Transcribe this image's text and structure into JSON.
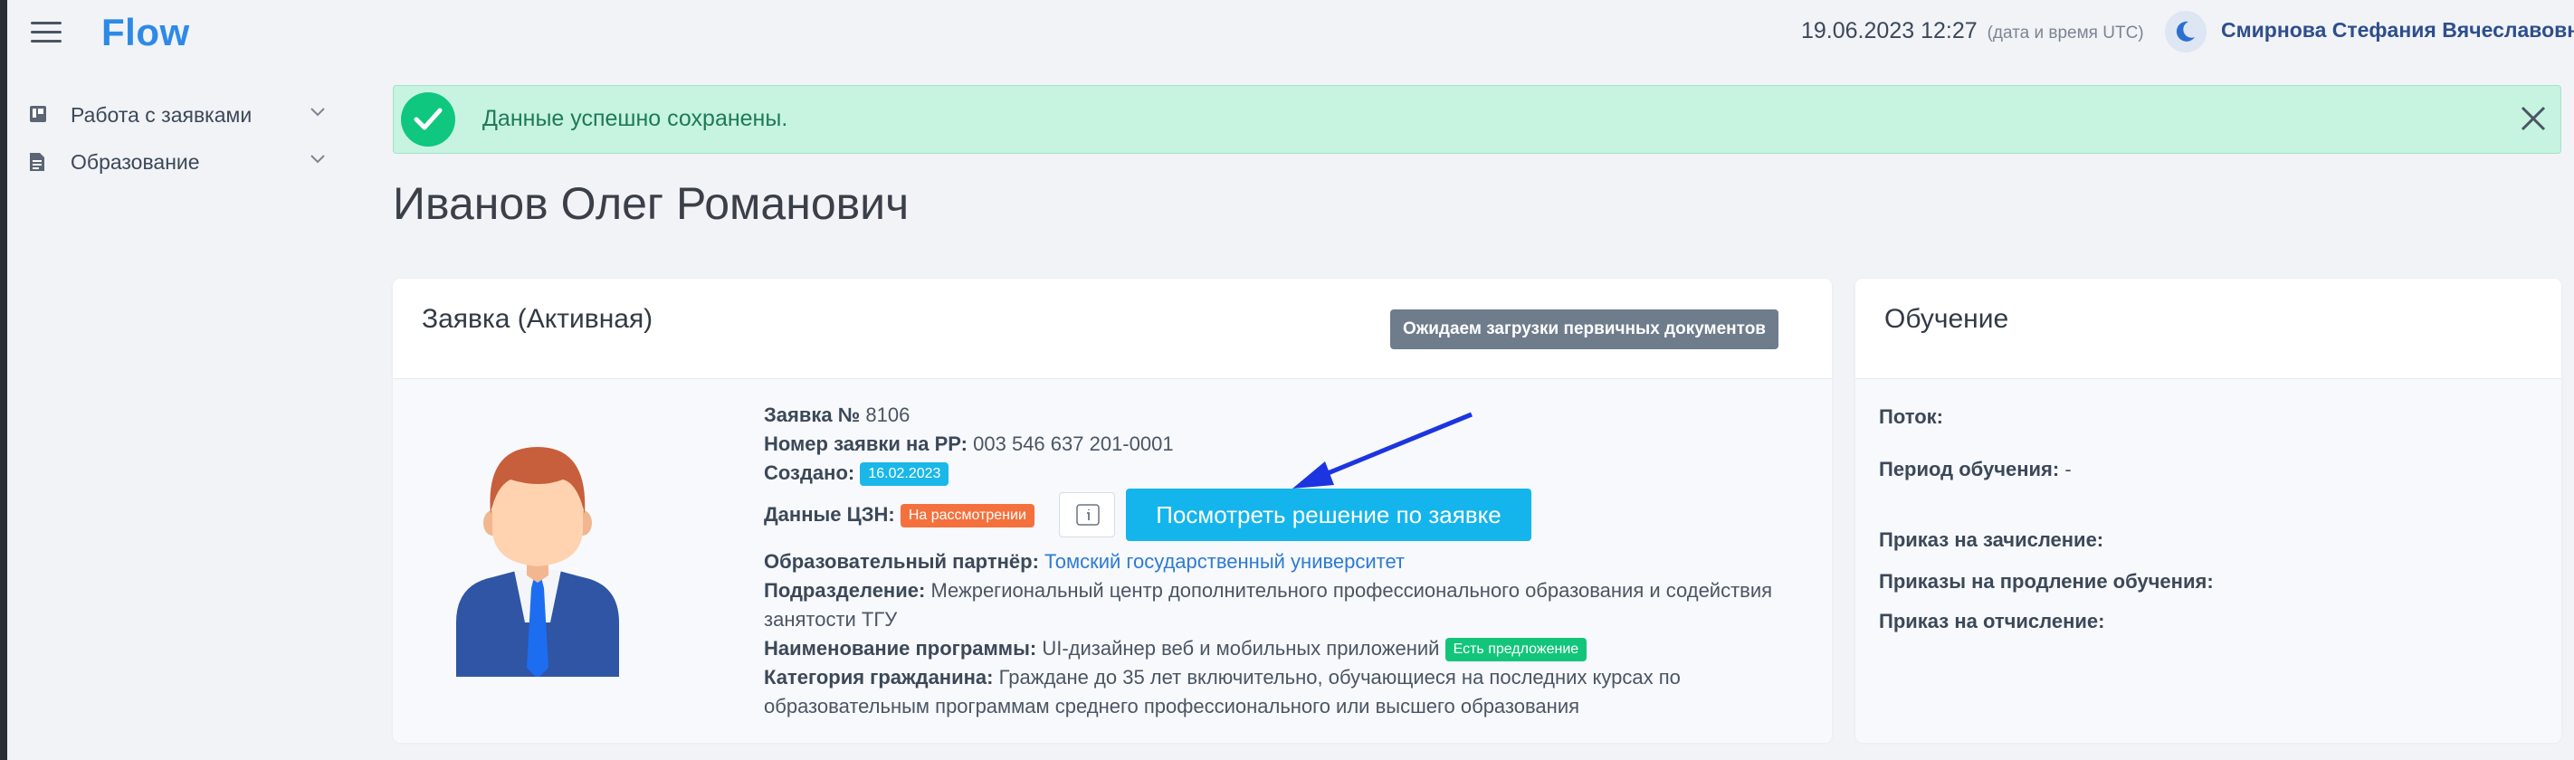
{
  "header": {
    "logo": "Flow",
    "datetime": "19.06.2023 12:27",
    "datetime_hint": "(дата и время UTC)",
    "user_name": "Смирнова Стефания Вячеславовна"
  },
  "sidebar": {
    "items": [
      {
        "label": "Работа с заявками",
        "icon": "board-icon"
      },
      {
        "label": "Образование",
        "icon": "document-icon"
      }
    ]
  },
  "alert": {
    "message": "Данные успешно сохранены."
  },
  "page_title": "Иванов Олег Романович",
  "application": {
    "title": "Заявка (Активная)",
    "status": "Ожидаем загрузки первичных документов",
    "number_label": "Заявка №",
    "number": "8106",
    "rr_label": "Номер заявки на РР:",
    "rr_number": "003 546 637 201-0001",
    "created_label": "Создано:",
    "created": "16.02.2023",
    "czn_label": "Данные ЦЗН:",
    "czn_status": "На рассмотрении",
    "decision_button": "Посмотреть решение по заявке",
    "partner_label": "Образовательный партнёр:",
    "partner": "Томский государственный университет",
    "division_label": "Подразделение:",
    "division_line1": "Межрегиональный центр дополнительного профессионального образования и содействия",
    "division_line2": "занятости ТГУ",
    "program_label": "Наименование программы:",
    "program": "UI-дизайнер веб и мобильных приложений",
    "program_badge": "Есть предложение",
    "category_label": "Категория гражданина:",
    "category_line1": "Граждане до 35 лет включительно, обучающиеся на последних курсах по",
    "category_line2": "образовательным программам среднего профессионального или высшего образования"
  },
  "education": {
    "title": "Обучение",
    "stream_label": "Поток:",
    "stream_value": "",
    "period_label": "Период обучения:",
    "period_value": "-",
    "enroll_label": "Приказ на зачисление:",
    "extend_label": "Приказы на продление обучения:",
    "expel_label": "Приказ на отчисление:"
  },
  "colors": {
    "accent": "#2d8ae6",
    "success_bg": "#c6f4e1",
    "success_icon": "#0fc77e",
    "button": "#14b5ec",
    "badge_orange": "#f4713e",
    "badge_green": "#13c57a",
    "status_pill": "#6e7c8c"
  }
}
